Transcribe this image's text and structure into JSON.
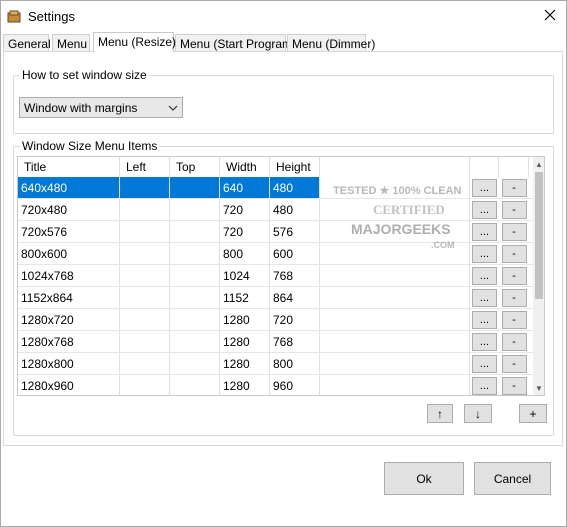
{
  "window": {
    "title": "Settings"
  },
  "tabs": [
    "General",
    "Menu",
    "Menu (Resize)",
    "Menu (Start Program)",
    "Menu (Dimmer)"
  ],
  "window_size_group": {
    "label": "How to set window size",
    "selected_option": "Window with margins"
  },
  "menu_items_group": {
    "label": "Window Size Menu Items",
    "columns": [
      "Title",
      "Left",
      "Top",
      "Width",
      "Height"
    ],
    "rows": [
      {
        "title": "640x480",
        "left": "",
        "top": "",
        "width": "640",
        "height": "480"
      },
      {
        "title": "720x480",
        "left": "",
        "top": "",
        "width": "720",
        "height": "480"
      },
      {
        "title": "720x576",
        "left": "",
        "top": "",
        "width": "720",
        "height": "576"
      },
      {
        "title": "800x600",
        "left": "",
        "top": "",
        "width": "800",
        "height": "600"
      },
      {
        "title": "1024x768",
        "left": "",
        "top": "",
        "width": "1024",
        "height": "768"
      },
      {
        "title": "1152x864",
        "left": "",
        "top": "",
        "width": "1152",
        "height": "864"
      },
      {
        "title": "1280x720",
        "left": "",
        "top": "",
        "width": "1280",
        "height": "720"
      },
      {
        "title": "1280x768",
        "left": "",
        "top": "",
        "width": "1280",
        "height": "768"
      },
      {
        "title": "1280x800",
        "left": "",
        "top": "",
        "width": "1280",
        "height": "800"
      },
      {
        "title": "1280x960",
        "left": "",
        "top": "",
        "width": "1280",
        "height": "960"
      }
    ],
    "row_more_label": "...",
    "row_remove_label": "-",
    "move_up_label": "↑",
    "move_down_label": "↓",
    "add_label": "+"
  },
  "footer": {
    "ok_label": "Ok",
    "cancel_label": "Cancel"
  },
  "watermark": {
    "line1": "TESTED ★ 100% CLEAN",
    "line2": "CERTIFIED",
    "line3": "MAJORGEEKS",
    "line4": ".COM"
  },
  "colors": {
    "selection": "#0078d7"
  }
}
